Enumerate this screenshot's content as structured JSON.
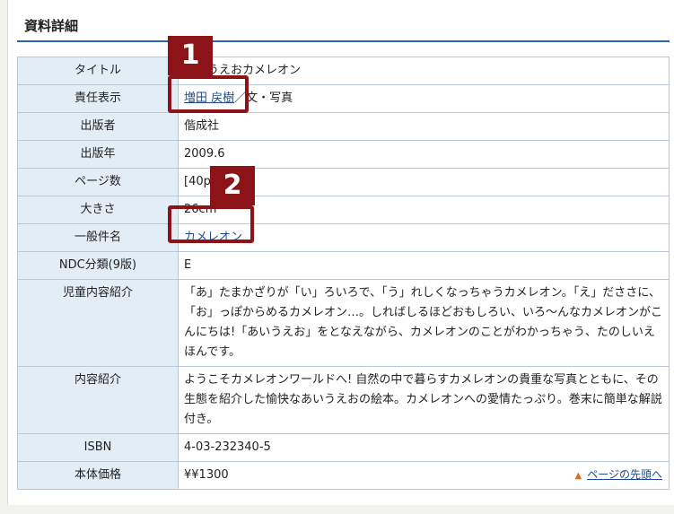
{
  "section": {
    "title": "資料詳細"
  },
  "rows": [
    {
      "label": "タイトル",
      "value": "あいうえおカメレオン"
    },
    {
      "label": "責任表示",
      "link": "増田 戻樹",
      "suffix": "／文・写真"
    },
    {
      "label": "出版者",
      "value": "偕成社"
    },
    {
      "label": "出版年",
      "value": "2009.6"
    },
    {
      "label": "ページ数",
      "value": "[40p]"
    },
    {
      "label": "大きさ",
      "value": "26cm"
    },
    {
      "label": "一般件名",
      "link": "カメレオン"
    },
    {
      "label": "NDC分類(9版)",
      "value": "E"
    },
    {
      "label": "児童内容紹介",
      "value": "「あ」たまかざりが「い」ろいろで、「う」れしくなっちゃうカメレオン。「え」だささに、「お」っぽからめるカメレオン…。しればしるほどおもしろい、いろ～んなカメレオンがこんにちは!「あいうえお」をとなえながら、カメレオンのことがわかっちゃう、たのしいえほんです。"
    },
    {
      "label": "内容紹介",
      "value": "ようこそカメレオンワールドへ! 自然の中で暮らすカメレオンの貴重な写真とともに、その生態を紹介した愉快なあいうえおの絵本。カメレオンへの愛情たっぷり。巻末に簡単な解説付き。"
    },
    {
      "label": "ISBN",
      "value": "4-03-232340-5"
    },
    {
      "label": "本体価格",
      "value": "¥¥1300"
    }
  ],
  "callouts": [
    "1",
    "2"
  ],
  "footer": {
    "pagetop": "ページの先頭へ"
  },
  "colors": {
    "accent_rule": "#2a64b2",
    "callout": "#8c1418",
    "label_bg": "#e3edf6",
    "link": "#1f4b8e"
  }
}
